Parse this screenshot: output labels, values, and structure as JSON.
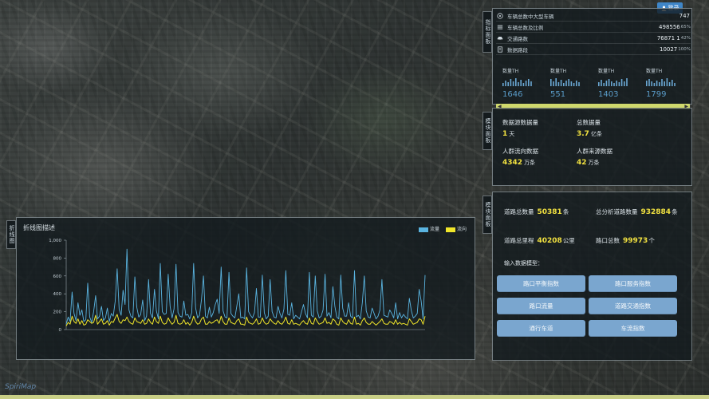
{
  "login": {
    "label": "登录",
    "icon": "user-icon"
  },
  "tabs": {
    "stats": "指标面板",
    "mid": "模块面板",
    "road": "模块面板",
    "chart": "折线图"
  },
  "stats_panel": {
    "rows": [
      {
        "icon": "target-icon",
        "label": "车辆总数中大型车辆",
        "value": "747",
        "pct": ""
      },
      {
        "icon": "list-icon",
        "label": "车辆总数及比例",
        "value": "498556",
        "pct": "65%"
      },
      {
        "icon": "car-icon",
        "label": "交通路数",
        "value": "76871 1",
        "pct": "42%"
      },
      {
        "icon": "doc-icon",
        "label": "数据路段",
        "value": "10027",
        "pct": "100%"
      }
    ],
    "kpis": [
      {
        "label": "数量TH",
        "value": "1646"
      },
      {
        "label": "数量TH",
        "value": "551"
      },
      {
        "label": "数量TH",
        "value": "1403"
      },
      {
        "label": "数量TH",
        "value": "1799"
      }
    ],
    "slider": {
      "left_arrow": "◀",
      "right_arrow": "▶"
    }
  },
  "mid_panel": {
    "items": [
      {
        "label": "数据源数据量",
        "value": "1",
        "unit": "天"
      },
      {
        "label": "总数据量",
        "value": "3.7",
        "unit": "亿条"
      },
      {
        "label": "人群流向数据",
        "value": "4342",
        "unit": "万条"
      },
      {
        "label": "人群来源数据",
        "value": "42",
        "unit": "万条"
      }
    ]
  },
  "road_panel": {
    "items": [
      {
        "label": "道路总数量",
        "value": "50381",
        "unit": "条"
      },
      {
        "label": "总分析道路数量",
        "value": "932884",
        "unit": "条"
      },
      {
        "label": "道路总里程",
        "value": "40208",
        "unit": "公里"
      },
      {
        "label": "路口总数",
        "value": "99973",
        "unit": "个"
      }
    ],
    "subtitle": "输入数据模型：",
    "buttons": [
      "路口平衡指数",
      "路口服务指数",
      "路口流量",
      "道路交通指数",
      "通行车道",
      "车流指数"
    ]
  },
  "chart_panel": {
    "title": "折线图描述",
    "legend": [
      {
        "name": "流量",
        "color": "#5ab4e0"
      },
      {
        "name": "流向",
        "color": "#f0e62a"
      }
    ]
  },
  "watermark": "SpiriMap",
  "chart_data": {
    "type": "line",
    "title": "折线图描述",
    "xlabel": "",
    "ylabel": "",
    "ylim": [
      0,
      1000
    ],
    "yticks": [
      0,
      200,
      400,
      600,
      800,
      1000
    ],
    "series": [
      {
        "name": "流量",
        "color": "#5ab4e0",
        "values": [
          60,
          140,
          90,
          420,
          180,
          100,
          300,
          160,
          220,
          90,
          110,
          520,
          140,
          80,
          200,
          380,
          120,
          150,
          260,
          100,
          130,
          240,
          90,
          180,
          150,
          320,
          680,
          230,
          160,
          440,
          280,
          900,
          220,
          150,
          130,
          590,
          250,
          140,
          170,
          330,
          100,
          150,
          560,
          180,
          130,
          450,
          210,
          120,
          740,
          200,
          170,
          180,
          620,
          260,
          130,
          230,
          730,
          190,
          150,
          140,
          320,
          160,
          170,
          120,
          190,
          740,
          240,
          130,
          160,
          340,
          600,
          150,
          130,
          250,
          140,
          190,
          280,
          340,
          180,
          700,
          210,
          140,
          130,
          640,
          180,
          150,
          130,
          260,
          400,
          130,
          140,
          120,
          690,
          200,
          160,
          130,
          190,
          460,
          140,
          140,
          610,
          190,
          120,
          150,
          560,
          200,
          140,
          130,
          260,
          180,
          130,
          230,
          660,
          170,
          160,
          300,
          120,
          160,
          140,
          120,
          200,
          280,
          180,
          130,
          640,
          160,
          140,
          600,
          210,
          130,
          150,
          220,
          620,
          150,
          190,
          130,
          480,
          260,
          140,
          120,
          610,
          240,
          150,
          150,
          300,
          150,
          130,
          660,
          140,
          160,
          120,
          300,
          600,
          210,
          140,
          130,
          240,
          180,
          120,
          150,
          220,
          560,
          160,
          150,
          140,
          220,
          180,
          130,
          300,
          120,
          190,
          130,
          170,
          140,
          120,
          350,
          210,
          130,
          150,
          180,
          450,
          320,
          120,
          610
        ]
      },
      {
        "name": "流向",
        "color": "#f0e62a",
        "values": [
          40,
          80,
          60,
          150,
          90,
          70,
          120,
          60,
          100,
          50,
          60,
          110,
          90,
          70,
          80,
          160,
          60,
          90,
          120,
          60,
          70,
          100,
          50,
          90,
          80,
          130,
          170,
          90,
          70,
          110,
          100,
          140,
          90,
          70,
          60,
          130,
          90,
          80,
          70,
          110,
          60,
          70,
          120,
          80,
          60,
          140,
          90,
          70,
          150,
          80,
          60,
          70,
          130,
          90,
          60,
          80,
          160,
          70,
          60,
          70,
          110,
          60,
          80,
          50,
          80,
          150,
          90,
          60,
          70,
          120,
          140,
          60,
          60,
          90,
          70,
          80,
          100,
          110,
          70,
          150,
          90,
          60,
          60,
          130,
          80,
          70,
          60,
          100,
          120,
          60,
          60,
          50,
          140,
          80,
          70,
          60,
          80,
          120,
          60,
          70,
          130,
          80,
          60,
          70,
          120,
          90,
          70,
          60,
          100,
          70,
          60,
          90,
          140,
          70,
          60,
          110,
          60,
          70,
          60,
          50,
          80,
          100,
          70,
          60,
          130,
          70,
          60,
          130,
          90,
          60,
          70,
          80,
          130,
          70,
          80,
          60,
          120,
          100,
          60,
          50,
          130,
          90,
          70,
          60,
          110,
          70,
          60,
          140,
          60,
          70,
          50,
          100,
          130,
          80,
          60,
          60,
          90,
          70,
          50,
          70,
          90,
          120,
          70,
          60,
          60,
          90,
          80,
          60,
          110,
          60,
          80,
          60,
          70,
          60,
          50,
          120,
          90,
          60,
          70,
          80,
          120,
          110,
          60,
          150
        ]
      }
    ]
  }
}
